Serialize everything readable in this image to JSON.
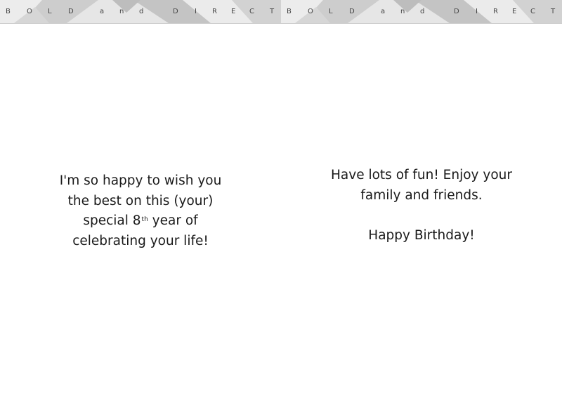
{
  "banner": {
    "letters": [
      "B",
      "O",
      "L",
      "D",
      "a",
      "n",
      "d",
      "D",
      "I",
      "R",
      "E",
      "C",
      "T"
    ],
    "colors": {
      "base": "#dcdcdc",
      "light": "#ececec",
      "mid": "#cdcdcd",
      "dark": "#bdbdbd",
      "text": "#444444"
    }
  },
  "left_panel": {
    "line1": "I'm so happy to wish you",
    "line2": "the best on this (your)",
    "line3_prefix": "special 8",
    "line3_sup": "th",
    "line3_suffix": " year of",
    "line4": "celebrating your life!"
  },
  "right_panel": {
    "line1": "Have lots of fun!  Enjoy your",
    "line2": "family and friends.",
    "line3": "Happy Birthday!"
  }
}
